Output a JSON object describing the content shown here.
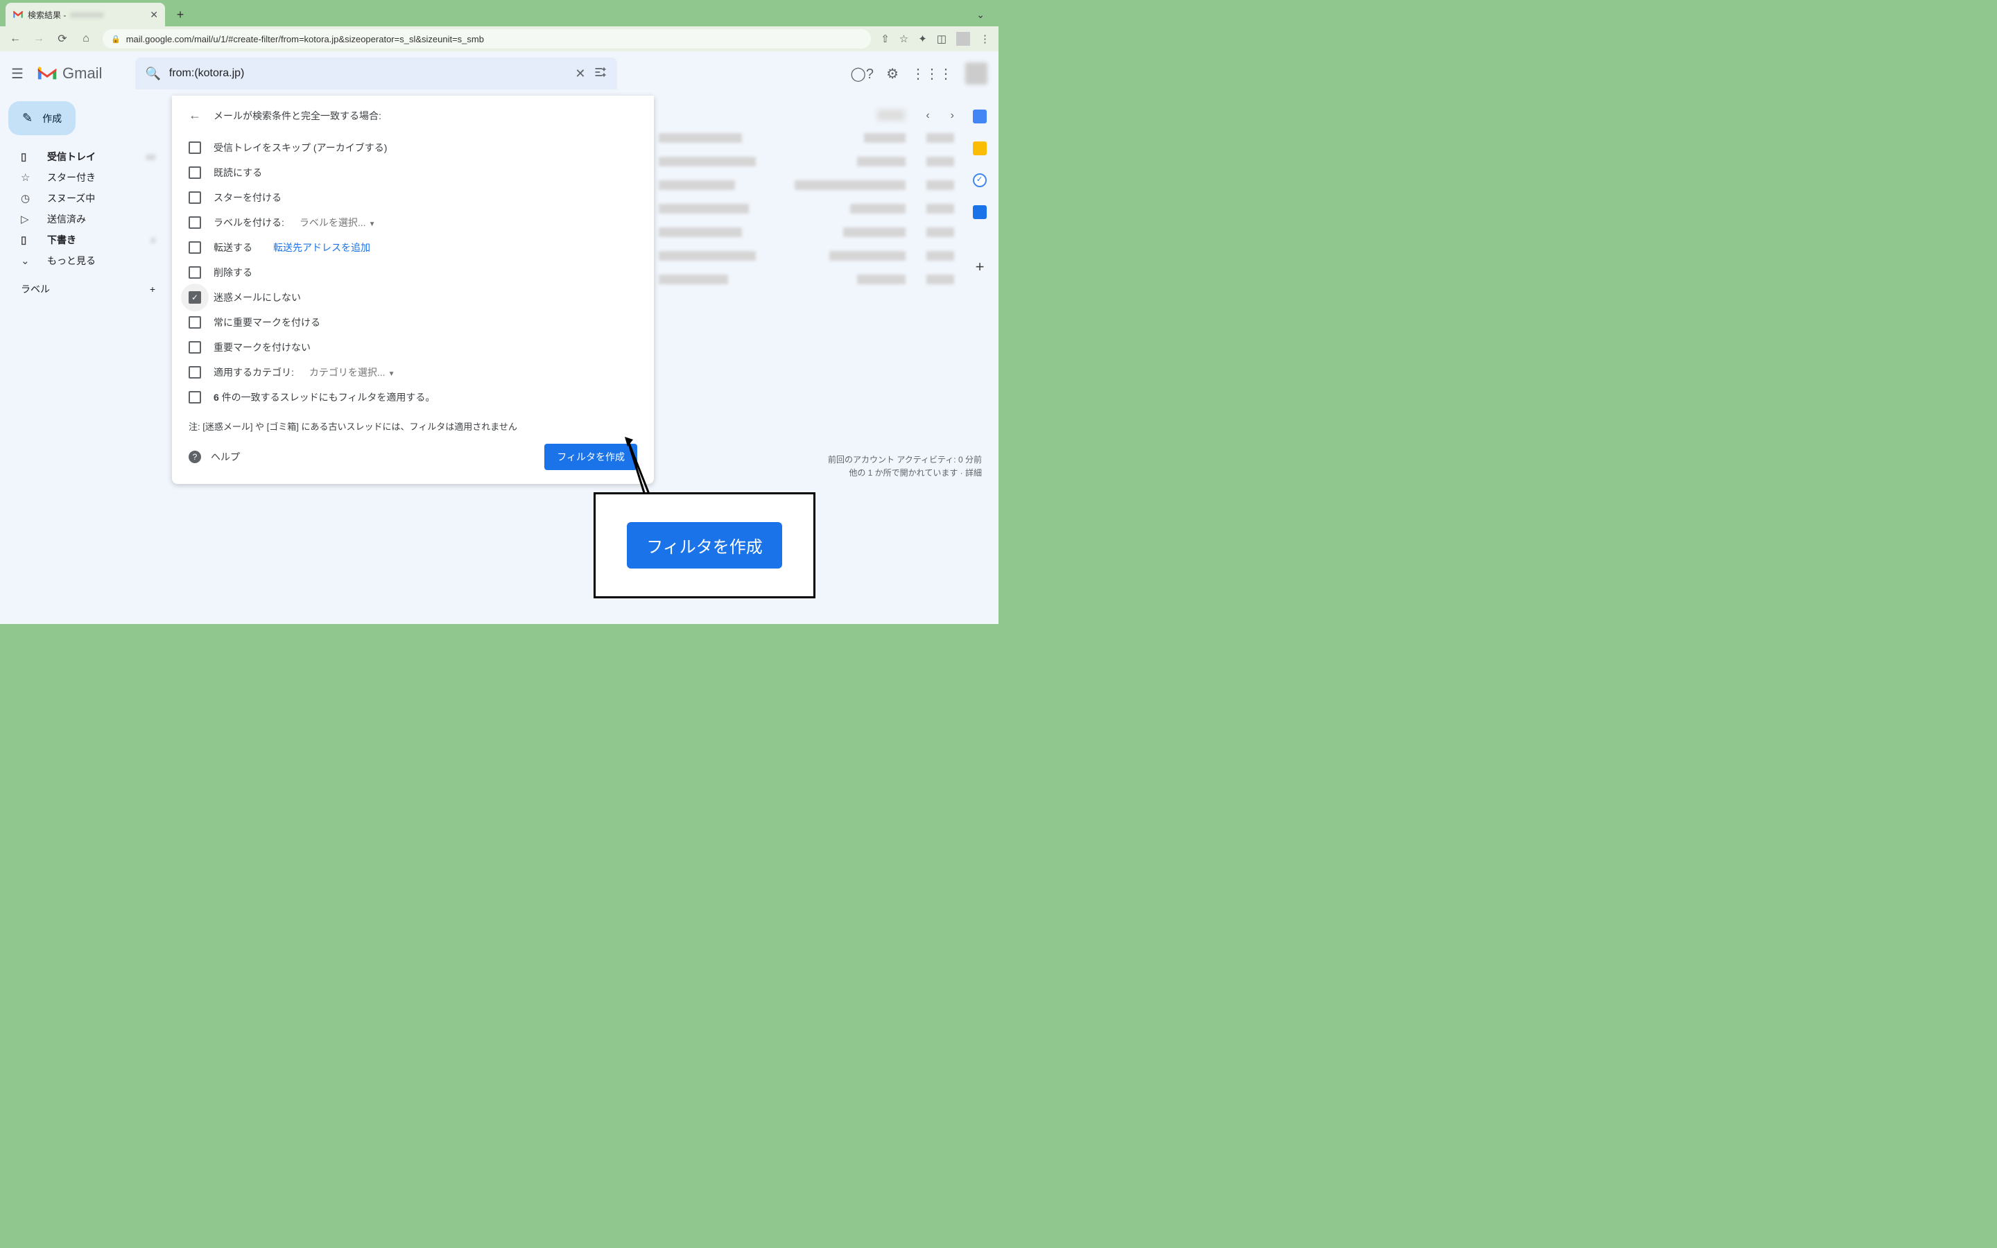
{
  "browser": {
    "tab_title": "検索結果 -",
    "url": "mail.google.com/mail/u/1/#create-filter/from=kotora.jp&sizeoperator=s_sl&sizeunit=s_smb"
  },
  "header": {
    "product": "Gmail",
    "search_value": "from:(kotora.jp)"
  },
  "compose_label": "作成",
  "sidebar": {
    "inbox": "受信トレイ",
    "starred": "スター付き",
    "snoozed": "スヌーズ中",
    "sent": "送信済み",
    "drafts": "下書き",
    "more": "もっと見る",
    "labels_header": "ラベル"
  },
  "filter": {
    "header": "メールが検索条件と完全一致する場合:",
    "skip_inbox": "受信トレイをスキップ (アーカイブする)",
    "mark_read": "既読にする",
    "star_it": "スターを付ける",
    "apply_label": "ラベルを付ける:",
    "apply_label_select": "ラベルを選択...",
    "forward": "転送する",
    "forward_add": "転送先アドレスを追加",
    "delete": "削除する",
    "not_spam": "迷惑メールにしない",
    "always_important": "常に重要マークを付ける",
    "never_important": "重要マークを付けない",
    "categorize": "適用するカテゴリ:",
    "categorize_select": "カテゴリを選択...",
    "apply_existing_prefix": "6",
    "apply_existing_suffix": " 件の一致するスレッドにもフィルタを適用する。",
    "note": "注: [迷惑メール] や [ゴミ箱] にある古いスレッドには、フィルタは適用されません",
    "help": "ヘルプ",
    "create_button": "フィルタを作成"
  },
  "footer": {
    "activity": "前回のアカウント アクティビティ: 0 分前",
    "open_elsewhere": "他の 1 か所で開かれています · 詳細"
  },
  "callout": {
    "button": "フィルタを作成"
  }
}
